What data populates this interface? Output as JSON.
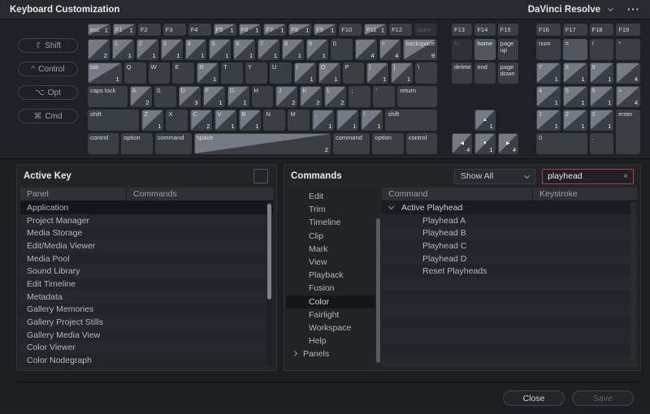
{
  "titlebar": {
    "title": "Keyboard Customization",
    "app_name": "DaVinci Resolve",
    "menu_dots": "···"
  },
  "modifier_buttons": [
    {
      "icon": "⇧",
      "label": "Shift"
    },
    {
      "icon": "^",
      "label": "Control"
    },
    {
      "icon": "⌥",
      "label": "Opt"
    },
    {
      "icon": "⌘",
      "label": "Cmd"
    }
  ],
  "keyboard": {
    "main": {
      "fn_row": [
        {
          "l": "esc",
          "n": "1",
          "t": true
        },
        {
          "l": "F1",
          "n": "1",
          "t": true
        },
        {
          "l": "F2"
        },
        {
          "l": "F3"
        },
        {
          "l": "F4"
        },
        {
          "l": "F5",
          "n": "1",
          "t": true
        },
        {
          "l": "F6",
          "n": "1",
          "t": true
        },
        {
          "l": "F7",
          "n": "1",
          "t": true
        },
        {
          "l": "F8",
          "n": "1",
          "t": true
        },
        {
          "l": "F9",
          "n": "1",
          "t": true
        },
        {
          "l": "F10"
        },
        {
          "l": "F11",
          "n": "1",
          "t": true
        },
        {
          "l": "F12"
        },
        {
          "l": "open",
          "v": "dim"
        }
      ],
      "rows": [
        [
          {
            "l": "`",
            "id": "backtick",
            "n": "2",
            "t": true
          },
          {
            "l": "1",
            "n": "1",
            "t": true
          },
          {
            "l": "2",
            "n": "1",
            "t": true
          },
          {
            "l": "3",
            "n": "1",
            "t": true
          },
          {
            "l": "4",
            "n": "1",
            "t": true
          },
          {
            "l": "5",
            "n": "1",
            "t": true
          },
          {
            "l": "6",
            "n": "1",
            "t": true
          },
          {
            "l": "7",
            "n": "1",
            "t": true
          },
          {
            "l": "8",
            "n": "1",
            "t": true
          },
          {
            "l": "9",
            "n": "1",
            "t": true
          },
          {
            "l": "0"
          },
          {
            "l": "-",
            "id": "minus",
            "n": "4",
            "t": true
          },
          {
            "l": "=",
            "id": "equals",
            "n": "4",
            "t": true
          },
          {
            "l": "backspace",
            "n": "9",
            "t": true,
            "u": 1.55
          }
        ],
        [
          {
            "l": "tab",
            "n": "1",
            "t": true,
            "u": 1.55
          },
          {
            "l": "Q"
          },
          {
            "l": "W"
          },
          {
            "l": "E"
          },
          {
            "l": "R",
            "n": "1",
            "t": true
          },
          {
            "l": "T"
          },
          {
            "l": "Y"
          },
          {
            "l": "U"
          },
          {
            "l": "I",
            "n": "1",
            "t": true
          },
          {
            "l": "O",
            "n": "1",
            "t": true
          },
          {
            "l": "P"
          },
          {
            "l": "[",
            "id": "bracket-left",
            "n": "1",
            "t": true
          },
          {
            "l": "]",
            "id": "bracket-right",
            "n": "1",
            "t": true
          },
          {
            "l": "\\",
            "id": "backslash"
          }
        ],
        [
          {
            "l": "caps lock",
            "u": 1.8
          },
          {
            "l": "A",
            "n": "2",
            "t": true
          },
          {
            "l": "S"
          },
          {
            "l": "D",
            "n": "3",
            "t": true
          },
          {
            "l": "F",
            "n": "1",
            "t": true
          },
          {
            "l": "G",
            "n": "1",
            "t": true
          },
          {
            "l": "H"
          },
          {
            "l": "J",
            "n": "2",
            "t": true
          },
          {
            "l": "K",
            "n": "2",
            "t": true
          },
          {
            "l": "L",
            "n": "2",
            "t": true
          },
          {
            "l": ";",
            "id": "semicolon"
          },
          {
            "l": "'",
            "id": "quote"
          },
          {
            "l": "return",
            "u": 1.8
          }
        ],
        [
          {
            "l": "shift",
            "u": 2.35
          },
          {
            "l": "Z",
            "n": "1",
            "t": true
          },
          {
            "l": "X"
          },
          {
            "l": "C",
            "n": "2",
            "t": true
          },
          {
            "l": "V",
            "n": "1",
            "t": true
          },
          {
            "l": "B",
            "n": "1",
            "t": true
          },
          {
            "l": "N"
          },
          {
            "l": "M"
          },
          {
            "l": ",",
            "id": "comma",
            "n": "1",
            "t": true
          },
          {
            "l": ".",
            "id": "period",
            "n": "1",
            "t": true
          },
          {
            "l": "/",
            "id": "slash",
            "n": "1",
            "t": true
          },
          {
            "l": "shift",
            "id": "shift-right",
            "u": 2.35
          }
        ],
        [
          {
            "l": "control",
            "u": 1.3
          },
          {
            "l": "option",
            "u": 1.3
          },
          {
            "l": "command",
            "u": 1.55
          },
          {
            "l": "space",
            "n": "2",
            "t": true,
            "u": 5.7
          },
          {
            "l": "command",
            "id": "command-right",
            "u": 1.55
          },
          {
            "l": "option",
            "id": "option-right",
            "u": 1.3
          },
          {
            "l": "control",
            "id": "control-right",
            "u": 1.3
          }
        ]
      ]
    },
    "nav": {
      "fn_row": [
        {
          "l": "F13"
        },
        {
          "l": "F14"
        },
        {
          "l": "F15"
        }
      ],
      "cells": [
        {
          "l": "fn",
          "v": "dim"
        },
        {
          "l": "home",
          "v": "light"
        },
        {
          "l": "page up",
          "two": true
        },
        {
          "l": "delete"
        },
        {
          "l": "end"
        },
        {
          "l": "page down",
          "two": true
        },
        null,
        null,
        null,
        null,
        {
          "l": "▲",
          "id": "up-arrow",
          "n": "1",
          "t": true,
          "a": true
        },
        null,
        {
          "l": "◀",
          "id": "left-arrow",
          "n": "4",
          "t": true,
          "a": true
        },
        {
          "l": "▼",
          "id": "down-arrow",
          "n": "1",
          "t": true,
          "a": true
        },
        {
          "l": "▶",
          "id": "right-arrow",
          "n": "4",
          "t": true,
          "a": true
        }
      ]
    },
    "numpad": {
      "fn_row": [
        {
          "l": "F16"
        },
        {
          "l": "F17"
        },
        {
          "l": "F18"
        },
        {
          "l": "F19"
        }
      ],
      "cells": [
        {
          "l": "num"
        },
        {
          "l": "=",
          "id": "numpad-equals",
          "v": "light"
        },
        {
          "l": "/",
          "id": "numpad-slash"
        },
        {
          "l": "*",
          "id": "numpad-asterisk"
        },
        {
          "l": "7",
          "id": "numpad-7",
          "n": "1",
          "t": true
        },
        {
          "l": "8",
          "id": "numpad-8",
          "n": "1",
          "t": true
        },
        {
          "l": "9",
          "id": "numpad-9",
          "n": "1",
          "t": true
        },
        {
          "l": "-",
          "id": "numpad-minus",
          "n": "4",
          "t": true
        },
        {
          "l": "4",
          "id": "numpad-4",
          "n": "1",
          "t": true
        },
        {
          "l": "5",
          "id": "numpad-5",
          "n": "1",
          "t": true
        },
        {
          "l": "6",
          "id": "numpad-6",
          "n": "1",
          "t": true
        },
        {
          "l": "+",
          "id": "numpad-plus",
          "n": "4",
          "t": true
        },
        {
          "l": "1",
          "id": "numpad-1",
          "n": "1",
          "t": true
        },
        {
          "l": "2",
          "id": "numpad-2",
          "n": "1",
          "t": true
        },
        {
          "l": "3",
          "id": "numpad-3",
          "n": "1",
          "t": true
        },
        {
          "l": "enter",
          "rs": 2
        },
        {
          "l": "0",
          "id": "numpad-0",
          "cs": 2
        },
        {
          "l": ".",
          "id": "numpad-period"
        }
      ]
    }
  },
  "active_key": {
    "title": "Active Key",
    "columns": [
      "Panel",
      "Commands"
    ],
    "rows": [
      {
        "panel": "Application",
        "commands": "",
        "selected": true
      },
      {
        "panel": "Project Manager",
        "commands": ""
      },
      {
        "panel": "Media Storage",
        "commands": ""
      },
      {
        "panel": "Edit/Media Viewer",
        "commands": ""
      },
      {
        "panel": "Media Pool",
        "commands": ""
      },
      {
        "panel": "Sound Library",
        "commands": ""
      },
      {
        "panel": "Edit Timeline",
        "commands": ""
      },
      {
        "panel": "Metadata",
        "commands": ""
      },
      {
        "panel": "Gallery Memories",
        "commands": ""
      },
      {
        "panel": "Gallery Project Stills",
        "commands": ""
      },
      {
        "panel": "Gallery Media View",
        "commands": ""
      },
      {
        "panel": "Color Viewer",
        "commands": ""
      },
      {
        "panel": "Color Nodegraph",
        "commands": ""
      }
    ]
  },
  "commands": {
    "title": "Commands",
    "filter_value": "Show All",
    "search_value": "playhead",
    "clear_icon": "×",
    "categories": [
      {
        "label": "Edit"
      },
      {
        "label": "Trim"
      },
      {
        "label": "Timeline"
      },
      {
        "label": "Clip"
      },
      {
        "label": "Mark"
      },
      {
        "label": "View"
      },
      {
        "label": "Playback"
      },
      {
        "label": "Fusion"
      },
      {
        "label": "Color",
        "selected": true
      },
      {
        "label": "Fairlight"
      },
      {
        "label": "Workspace"
      },
      {
        "label": "Help"
      },
      {
        "label": "Panels",
        "expander": true
      }
    ],
    "columns": [
      "Command",
      "Keystroke"
    ],
    "rows": [
      {
        "command": "Active Playhead",
        "keystroke": "",
        "group": true,
        "expanded": true
      },
      {
        "command": "Playhead A",
        "keystroke": ""
      },
      {
        "command": "Playhead B",
        "keystroke": ""
      },
      {
        "command": "Playhead C",
        "keystroke": ""
      },
      {
        "command": "Playhead D",
        "keystroke": ""
      },
      {
        "command": "Reset Playheads",
        "keystroke": ""
      }
    ]
  },
  "footer": {
    "close_label": "Close",
    "save_label": "Save",
    "save_disabled": true
  },
  "colors": {
    "search_alert_border": "#a8453c",
    "key_triangle": "#747b85",
    "selected_row": "#15161a"
  }
}
